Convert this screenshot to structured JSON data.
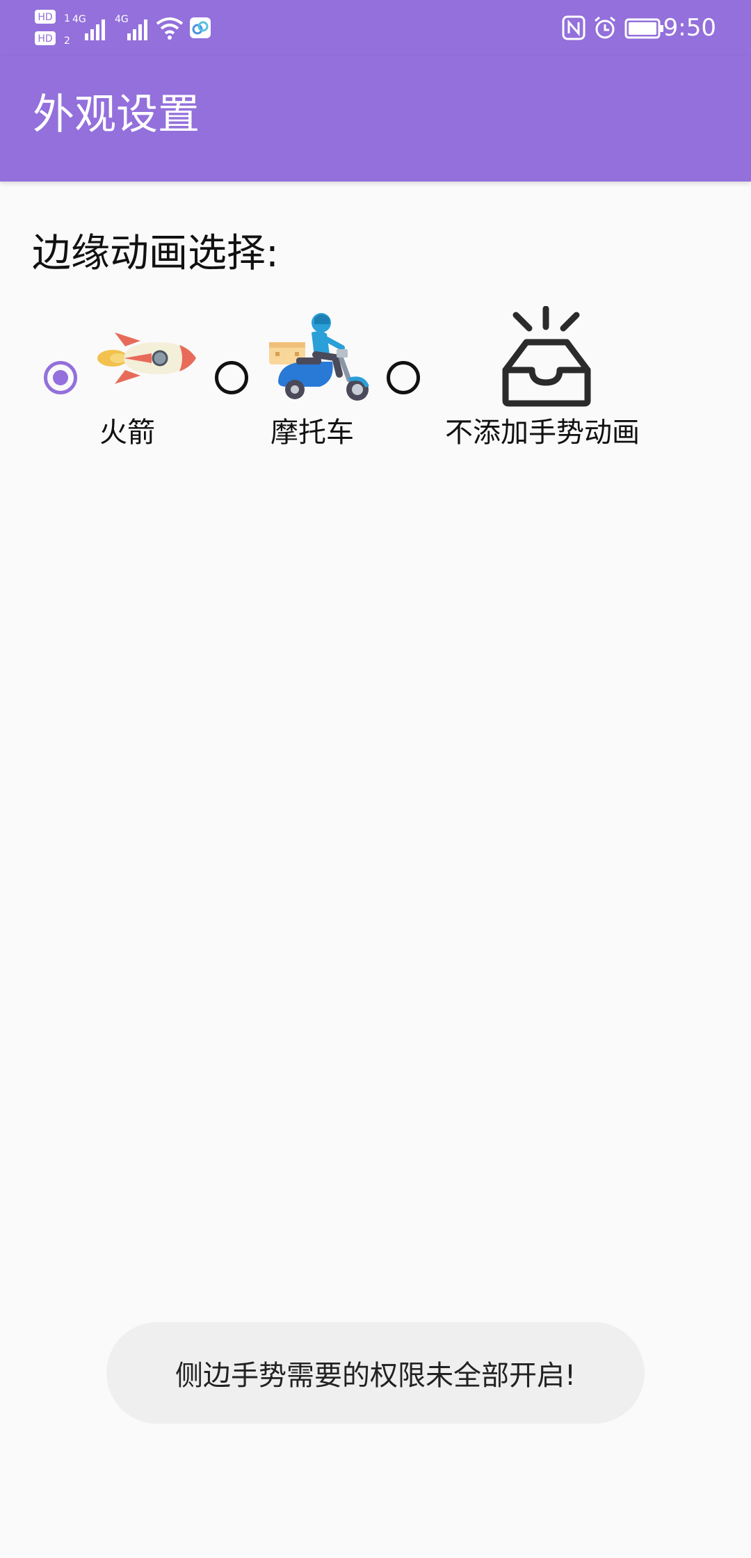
{
  "status_bar": {
    "left_indicators": [
      "HD 1",
      "HD 2",
      "4G",
      "4G"
    ],
    "right_icons": [
      "nfc-icon",
      "alarm-icon",
      "battery-icon"
    ],
    "time": "9:50"
  },
  "app_bar": {
    "title": "外观设置",
    "background_color": "#9370db"
  },
  "section": {
    "title": "边缘动画选择:"
  },
  "options": [
    {
      "label": "火箭",
      "icon": "rocket-icon",
      "selected": true
    },
    {
      "label": "摩托车",
      "icon": "motorcycle-icon",
      "selected": false
    },
    {
      "label": "不添加手势动画",
      "icon": "inbox-icon",
      "selected": false
    }
  ],
  "toast": {
    "message": "侧边手势需要的权限未全部开启!"
  }
}
